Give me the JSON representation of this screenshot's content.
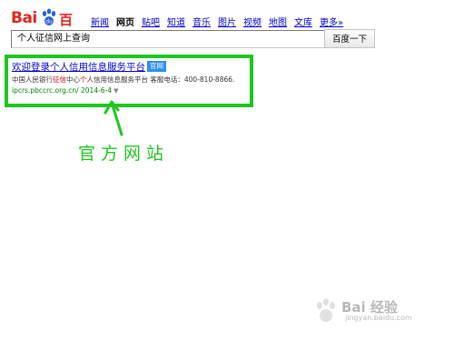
{
  "logo": {
    "part1": "Bai",
    "part2": "百度"
  },
  "nav": {
    "items": [
      "新闻",
      "网页",
      "贴吧",
      "知道",
      "音乐",
      "图片",
      "视频",
      "地图",
      "文库",
      "更多»"
    ],
    "active_index": 1
  },
  "search": {
    "value": "个人征信网上查询",
    "button_label": "百度一下"
  },
  "result": {
    "title": "欢迎登录个人信用信息服务平台",
    "badge": "官网",
    "abstract_pre": "中国人民银行",
    "abstract_hl1": "征信",
    "abstract_mid": "中心",
    "abstract_hl2": "个人",
    "abstract_post": "信用信息服务平台 客服电话：400-810-8866.",
    "url": "ipcrs.pbccrc.org.cn/ 2014-6-4"
  },
  "annotation": {
    "text": "官方网站",
    "color": "#1ec61e"
  },
  "watermark": {
    "text": "Bai 经验",
    "sub": "jingyan.baidu.com"
  },
  "colors": {
    "brand_red": "#e1251b",
    "link_blue": "#0000cc",
    "url_green": "#008000",
    "highlight": "#1ec61e"
  }
}
